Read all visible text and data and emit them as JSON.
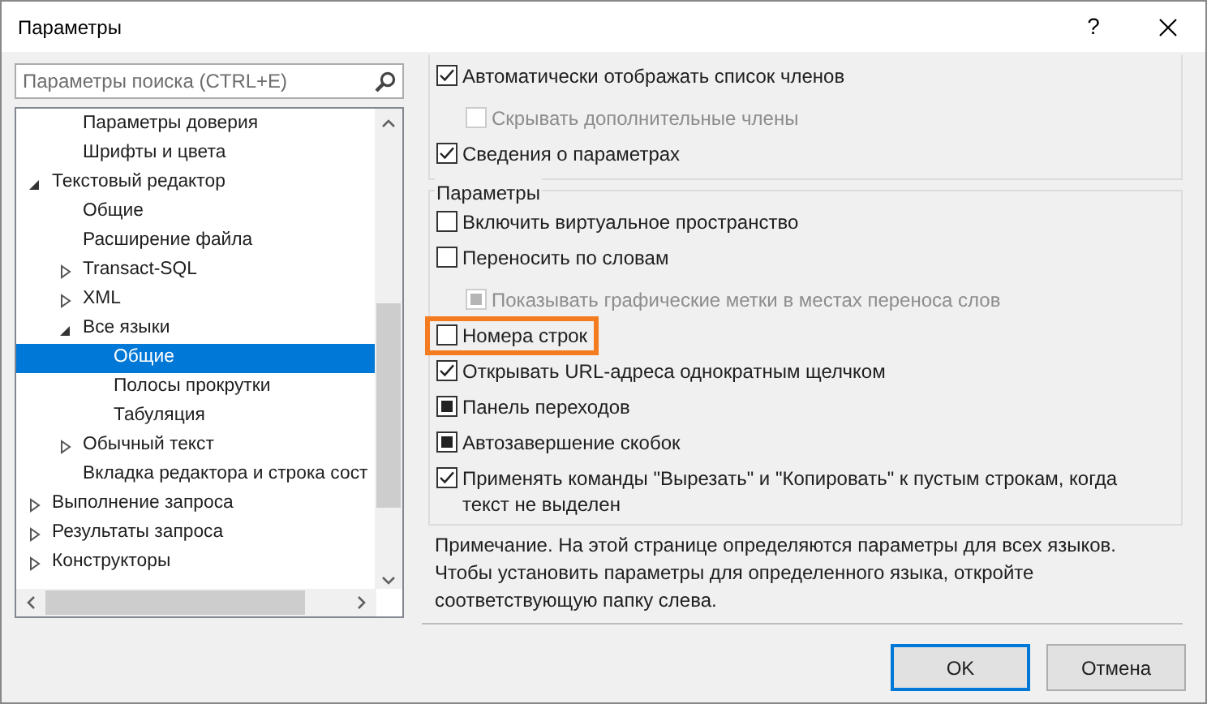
{
  "window": {
    "title": "Параметры",
    "buttons": [
      "?"
    ]
  },
  "search": {
    "placeholder": "Параметры поиска (CTRL+E)"
  },
  "tree": [
    {
      "children": [
        {
          "label": "Параметры доверия",
          "kind": "leaf",
          "selected": false
        },
        {
          "label": "Шрифты и цвета",
          "kind": "leaf",
          "selected": false
        }
      ]
    },
    {
      "label": "Текстовый редактор",
      "kind": "folder",
      "expanded": true,
      "selected": false,
      "children": [
        {
          "label": "Общие",
          "kind": "leaf",
          "selected": false
        },
        {
          "label": "Расширение файла",
          "kind": "leaf",
          "selected": false
        },
        {
          "label": "Transact-SQL",
          "kind": "folder",
          "expanded": false,
          "selected": false
        },
        {
          "label": "XML",
          "kind": "folder",
          "expanded": false,
          "selected": false
        },
        {
          "label": "Все языки",
          "kind": "folder",
          "expanded": true,
          "selected": false,
          "children": [
            {
              "label": "Общие",
              "kind": "leaf",
              "selected": true
            },
            {
              "label": "Полосы прокрутки",
              "kind": "leaf",
              "selected": false
            },
            {
              "label": "Табуляция",
              "kind": "leaf",
              "selected": false
            }
          ]
        },
        {
          "label": "Обычный текст",
          "kind": "folder",
          "expanded": false,
          "selected": false
        },
        {
          "label": "Вкладка редактора и строка сост",
          "kind": "leaf",
          "selected": false
        }
      ]
    },
    {
      "label": "Выполнение запроса",
      "kind": "folder",
      "expanded": false,
      "selected": false
    },
    {
      "label": "Результаты запроса",
      "kind": "folder",
      "expanded": false,
      "selected": false
    },
    {
      "label": "Конструкторы",
      "kind": "folder",
      "expanded": false,
      "selected": false
    }
  ],
  "groups": [
    {
      "options": [
        {
          "label": "Автоматически отображать список членов",
          "kind": "checkbox",
          "checked": true,
          "disabled": false,
          "highlighted": false,
          "children": [
            {
              "label": "Скрывать дополнительные члены",
              "kind": "checkbox",
              "checked": false,
              "disabled": true,
              "highlighted": false
            }
          ]
        },
        {
          "label": "Сведения о параметрах",
          "kind": "checkbox",
          "checked": true,
          "disabled": false,
          "highlighted": false
        }
      ]
    },
    {
      "title": "Параметры",
      "options": [
        {
          "label": "Включить виртуальное пространство",
          "kind": "checkbox",
          "checked": false,
          "disabled": false,
          "highlighted": false
        },
        {
          "label": "Переносить по словам",
          "kind": "checkbox",
          "checked": false,
          "disabled": false,
          "highlighted": false,
          "children": [
            {
              "label": "Показывать графические метки в местах переноса слов",
              "kind": "mixed",
              "disabled": true,
              "highlighted": false
            }
          ]
        },
        {
          "label": "Номера строк",
          "kind": "checkbox",
          "checked": false,
          "disabled": false,
          "highlighted": true
        },
        {
          "label": "Открывать URL-адреса однократным щелчком",
          "kind": "checkbox",
          "checked": true,
          "disabled": false,
          "highlighted": false
        },
        {
          "label": "Панель переходов",
          "kind": "mixed",
          "disabled": false,
          "highlighted": false
        },
        {
          "label": "Автозавершение скобок",
          "kind": "mixed",
          "disabled": false,
          "highlighted": false
        },
        {
          "label": "Применять команды \"Вырезать\" и \"Копировать\" к пустым строкам, когда текст не выделен",
          "kind": "checkbox",
          "checked": true,
          "disabled": false,
          "highlighted": false
        }
      ]
    }
  ],
  "note": "Примечание. На этой странице определяются параметры для всех языков. Чтобы установить параметры для определенного языка, откройте соответствующую папку слева.",
  "buttons": [
    {
      "label": "OK",
      "default": true
    },
    {
      "label": "Отмена",
      "default": false
    }
  ]
}
